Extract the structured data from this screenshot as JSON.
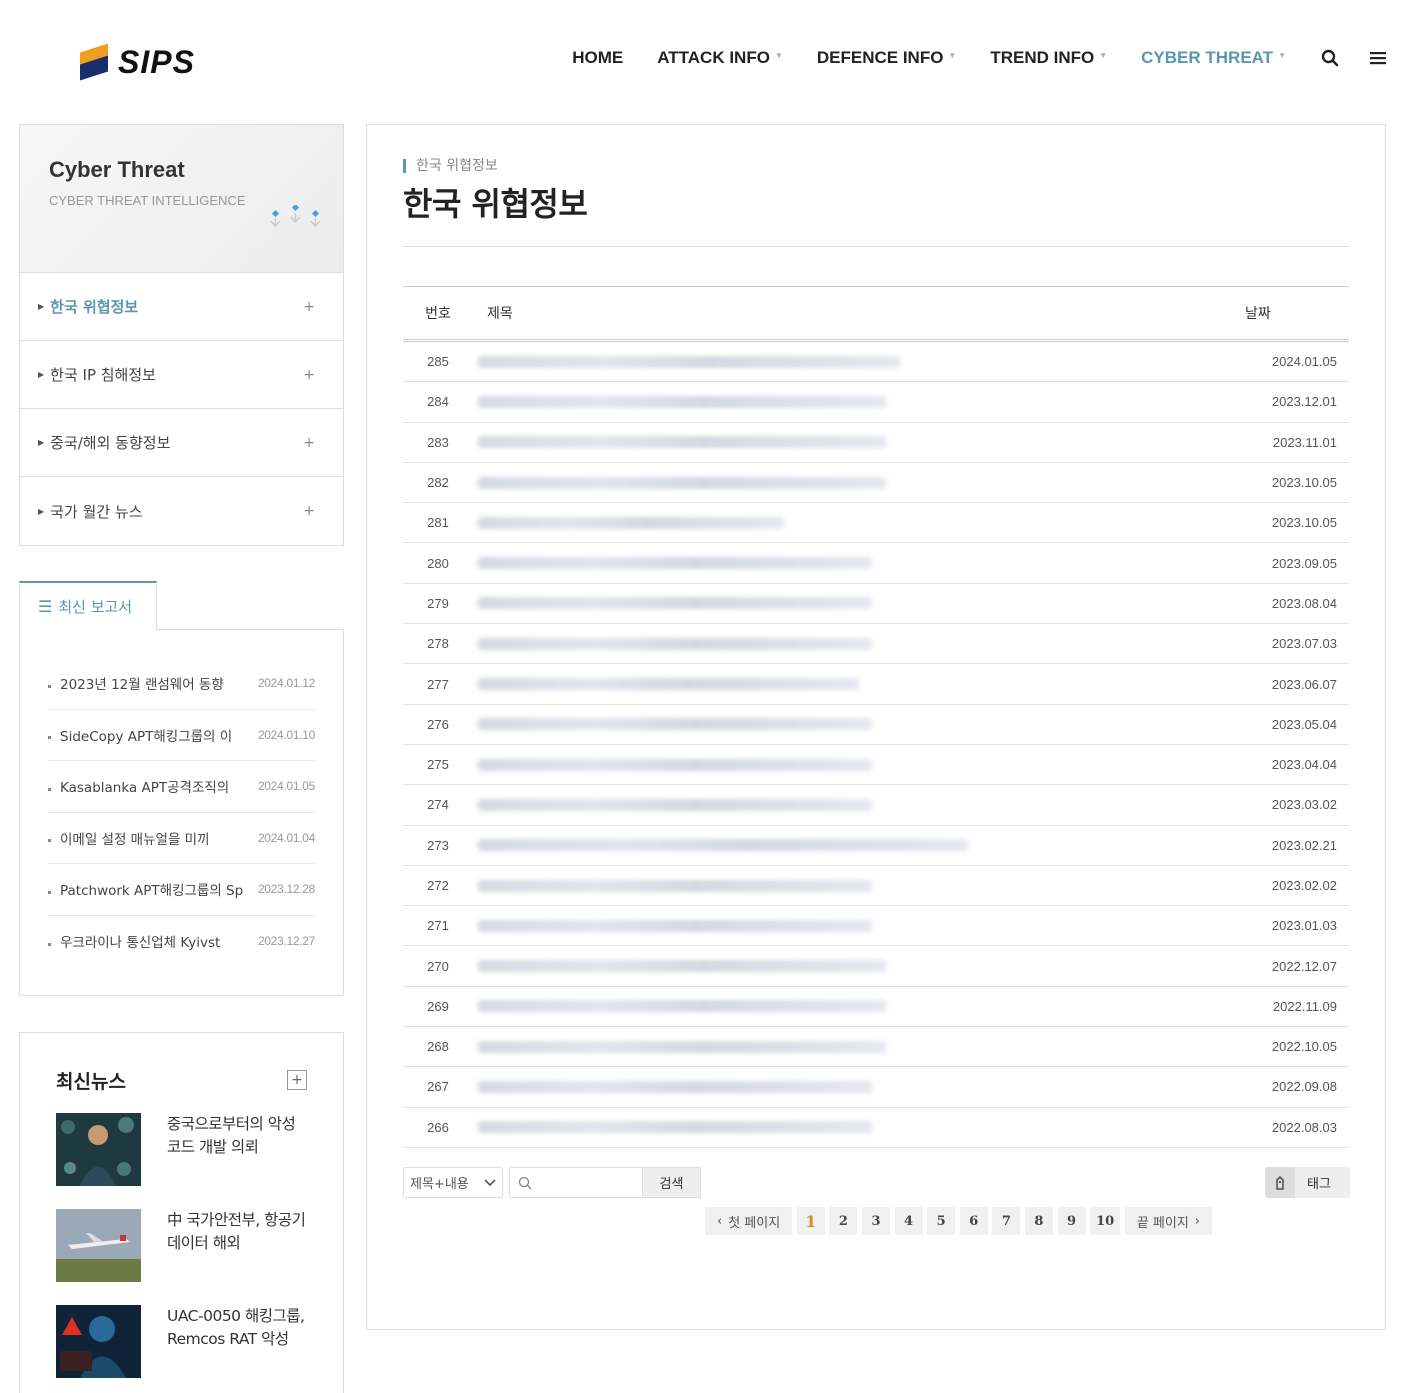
{
  "header": {
    "logo_text": "SIPS",
    "nav": [
      {
        "label": "HOME",
        "has_caret": false,
        "active": false
      },
      {
        "label": "ATTACK INFO",
        "has_caret": true,
        "active": false
      },
      {
        "label": "DEFENCE INFO",
        "has_caret": true,
        "active": false
      },
      {
        "label": "TREND INFO",
        "has_caret": true,
        "active": false
      },
      {
        "label": "CYBER THREAT",
        "has_caret": true,
        "active": true
      }
    ],
    "accent_color": "#5b97ad"
  },
  "sidebar": {
    "title": "Cyber Threat",
    "subtitle": "CYBER THREAT INTELLIGENCE",
    "menu": [
      {
        "label": "한국 위협정보",
        "active": true
      },
      {
        "label": "한국 IP 침해정보",
        "active": false
      },
      {
        "label": "중국/해외 동향정보",
        "active": false
      },
      {
        "label": "국가 월간 뉴스",
        "active": false
      }
    ],
    "plus_glyph": "+"
  },
  "reports": {
    "tab_label": "최신 보고서",
    "items": [
      {
        "title": "2023년 12월 랜섬웨어 동향",
        "date": "2024.01.12"
      },
      {
        "title": "SideCopy APT해킹그룹의 이",
        "date": "2024.01.10"
      },
      {
        "title": "Kasablanka APT공격조직의",
        "date": "2024.01.05"
      },
      {
        "title": "이메일 설정 매뉴얼을 미끼",
        "date": "2024.01.04"
      },
      {
        "title": "Patchwork APT해킹그룹의 Sp",
        "date": "2023.12.28"
      },
      {
        "title": "우크라이나 통신업체 Kyivst",
        "date": "2023.12.27"
      }
    ]
  },
  "news": {
    "title": "최신뉴스",
    "items": [
      {
        "text": "중국으로부터의 악성코드 개발 의뢰"
      },
      {
        "text": "中 국가안전부, 항공기 데이터 해외"
      },
      {
        "text": "UAC-0050 해킹그룹, Remcos RAT 악성"
      }
    ]
  },
  "main": {
    "breadcrumb": "한국 위협정보",
    "title": "한국 위협정보",
    "columns": {
      "num": "번호",
      "title": "제목",
      "date": "날짜"
    },
    "rows": [
      {
        "num": "285",
        "date": "2024.01.05",
        "blur_width": 0.62
      },
      {
        "num": "284",
        "date": "2023.12.01",
        "blur_width": 0.6
      },
      {
        "num": "283",
        "date": "2023.11.01",
        "blur_width": 0.6
      },
      {
        "num": "282",
        "date": "2023.10.05",
        "blur_width": 0.6
      },
      {
        "num": "281",
        "date": "2023.10.05",
        "blur_width": 0.45
      },
      {
        "num": "280",
        "date": "2023.09.05",
        "blur_width": 0.58
      },
      {
        "num": "279",
        "date": "2023.08.04",
        "blur_width": 0.58
      },
      {
        "num": "278",
        "date": "2023.07.03",
        "blur_width": 0.58
      },
      {
        "num": "277",
        "date": "2023.06.07",
        "blur_width": 0.56
      },
      {
        "num": "276",
        "date": "2023.05.04",
        "blur_width": 0.58
      },
      {
        "num": "275",
        "date": "2023.04.04",
        "blur_width": 0.58
      },
      {
        "num": "274",
        "date": "2023.03.02",
        "blur_width": 0.58
      },
      {
        "num": "273",
        "date": "2023.02.21",
        "blur_width": 0.72
      },
      {
        "num": "272",
        "date": "2023.02.02",
        "blur_width": 0.58
      },
      {
        "num": "271",
        "date": "2023.01.03",
        "blur_width": 0.58
      },
      {
        "num": "270",
        "date": "2022.12.07",
        "blur_width": 0.6
      },
      {
        "num": "269",
        "date": "2022.11.09",
        "blur_width": 0.6
      },
      {
        "num": "268",
        "date": "2022.10.05",
        "blur_width": 0.6
      },
      {
        "num": "267",
        "date": "2022.09.08",
        "blur_width": 0.58
      },
      {
        "num": "266",
        "date": "2022.08.03",
        "blur_width": 0.58
      }
    ],
    "search": {
      "select_value": "제목+내용",
      "button_label": "검색",
      "tag_label": "태그"
    },
    "pager": {
      "first_label": "첫 페이지",
      "last_label": "끝 페이지",
      "pages": [
        "1",
        "2",
        "3",
        "4",
        "5",
        "6",
        "7",
        "8",
        "9",
        "10"
      ],
      "current": "1"
    }
  }
}
